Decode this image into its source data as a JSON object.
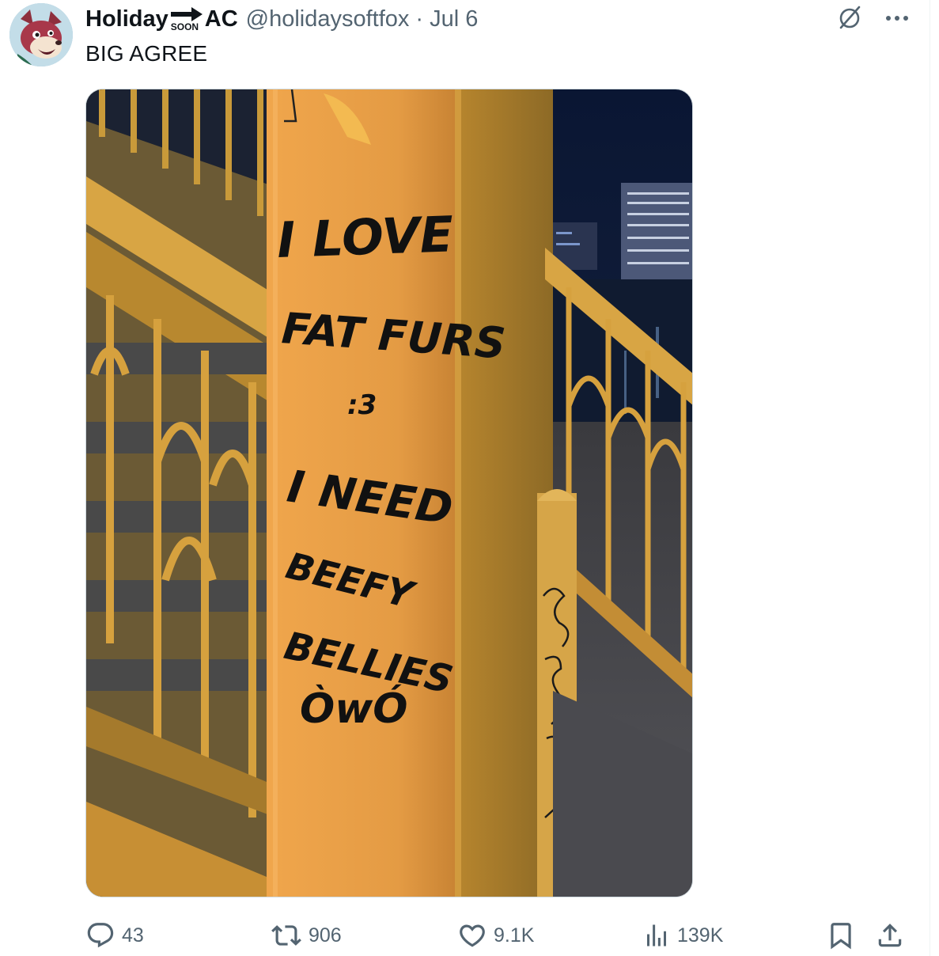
{
  "tweet": {
    "display_name_start": "Holiday",
    "badge_text": "SOON",
    "display_name_end": "AC",
    "handle": "@holidaysoftfox",
    "separator": "·",
    "date": "Jul 6",
    "text": "BIG AGREE"
  },
  "image": {
    "graffiti_lines": [
      "I LOVE",
      "FAT FURS",
      ":3",
      "I NEED",
      "BEEFY",
      "BELLIES",
      "ÒwÓ"
    ]
  },
  "actions": {
    "replies": "43",
    "reposts": "906",
    "likes": "9.1K",
    "views": "139K"
  },
  "colors": {
    "text_primary": "#0f1419",
    "text_secondary": "#536471",
    "railing": "#d9a23c",
    "post": "#e39a3e",
    "night_sky": "#0b1a3a"
  },
  "icons": {
    "grok": "slashed-circle-icon",
    "more": "more-dots-icon",
    "reply": "reply-icon",
    "repost": "repost-icon",
    "like": "heart-icon",
    "views": "views-chart-icon",
    "bookmark": "bookmark-icon",
    "share": "share-icon"
  }
}
